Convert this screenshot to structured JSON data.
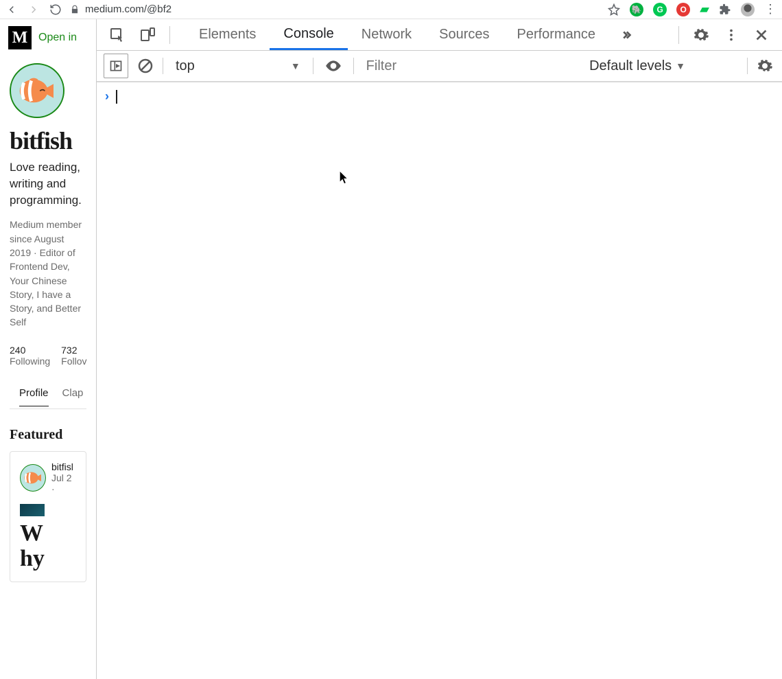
{
  "browser": {
    "url": "medium.com/@bf2",
    "extensions": [
      "evernote",
      "grammarly",
      "adblock",
      "postman",
      "extensions",
      "profile"
    ]
  },
  "page": {
    "open_in": "Open in",
    "profile": {
      "name": "bitfish",
      "bio": "Love reading, writing and programming.",
      "meta": "Medium member since August 2019 · Editor of Frontend Dev, Your Chinese Story, I have a Story, and Better Self",
      "following_count": "240",
      "following_label": "Following",
      "followers_count": "732",
      "followers_label": "Follov"
    },
    "tabs": {
      "profile": "Profile",
      "claps": "Clap"
    },
    "featured_heading": "Featured",
    "article": {
      "author": "bitfisl",
      "date": "Jul 2 ·",
      "title_frag": "W\nhy"
    }
  },
  "devtools": {
    "tabs": {
      "elements": "Elements",
      "console": "Console",
      "network": "Network",
      "sources": "Sources",
      "performance": "Performance"
    },
    "toolbar": {
      "context": "top",
      "filter_placeholder": "Filter",
      "levels": "Default levels"
    }
  }
}
